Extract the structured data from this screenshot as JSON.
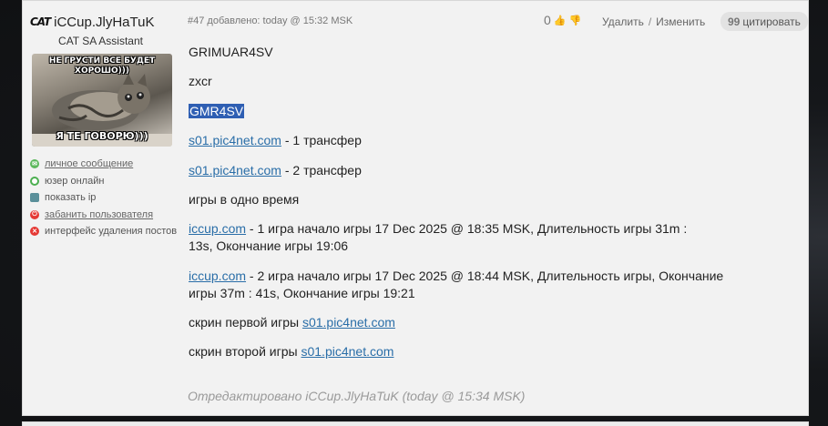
{
  "user": {
    "clan_tag": "CAT",
    "name": "iCCup.JlyHaTuK",
    "title": "CAT SA Assistant",
    "avatar_caption_top": "НЕ ГРУСТИ ВСЕ БУДЕТ ХОРОШО)))",
    "avatar_caption_bottom": "Я ТЕ ГОВОРЮ)))"
  },
  "actions": [
    {
      "label": "личное сообщение",
      "icon": "message-icon",
      "color": "#5cb85c",
      "link": true
    },
    {
      "label": "юзер онлайн",
      "icon": "online-icon",
      "color": "#4caf50",
      "link": false
    },
    {
      "label": "показать ip",
      "icon": "ip-icon",
      "color": "#5a8f9a",
      "link": false
    },
    {
      "label": "забанить пользователя",
      "icon": "ban-icon",
      "color": "#e53935",
      "link": true
    },
    {
      "label": "интерфейс удаления постов",
      "icon": "delete-icon",
      "color": "#e53935",
      "link": false
    }
  ],
  "post": {
    "meta": "#47 добавлено: today @ 15:32 MSK",
    "rating": "0",
    "delete_label": "Удалить",
    "separator": "/",
    "edit_label": "Изменить",
    "quote_label": "цитировать",
    "quote_mark": "99",
    "edited_note": "Отредактировано iCCup.JlyHaTuK (today @ 15:34 MSK)"
  },
  "content": {
    "line1": "GRIMUAR4SV",
    "line2": "zxcr",
    "line3": "GMR4SV",
    "link1": "s01.pic4net.com",
    "link1_after": " - 1 трансфер",
    "link2": "s01.pic4net.com",
    "link2_after": " - 2 трансфер",
    "line_games": "игры в одно время",
    "game1_link": "iccup.com",
    "game1_text": " - 1 игра начало игры 17 Dec 2025 @ 18:35 MSK, Длительность игры 31m : 13s, Окончание игры 19:06",
    "game2_link": "iccup.com",
    "game2_text": " - 2 игра начало игры 17 Dec 2025 @ 18:44 MSK, Длительность игры, Окончание игры 37m : 41s, Окончание игры 19:21",
    "screen1_text": "скрин первой игры ",
    "screen1_link": "s01.pic4net.com",
    "screen2_text": "скрин второй игры ",
    "screen2_link": "s01.pic4net.com"
  }
}
